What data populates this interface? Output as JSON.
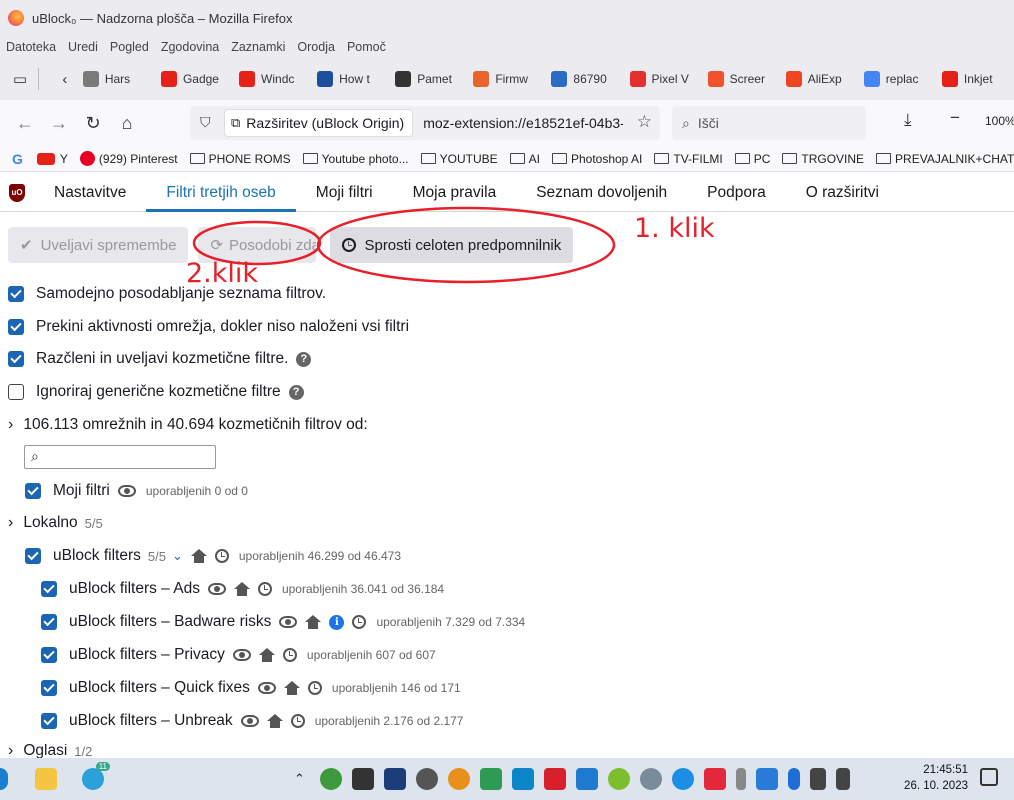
{
  "window": {
    "title": "uBlock₀ — Nadzorna plošča – Mozilla Firefox"
  },
  "menu": [
    "Datoteka",
    "Uredi",
    "Pogled",
    "Zgodovina",
    "Zaznamki",
    "Orodja",
    "Pomoč"
  ],
  "tabs": [
    {
      "label": "Hars",
      "color": "#7a7a7a"
    },
    {
      "label": "Gadge",
      "color": "#e62117"
    },
    {
      "label": "Windc",
      "color": "#e62117"
    },
    {
      "label": "How t",
      "color": "#1e4f9c"
    },
    {
      "label": "Pamet",
      "color": "#333333"
    },
    {
      "label": "Firmw",
      "color": "#e8642c"
    },
    {
      "label": "86790",
      "color": "#2a6bc4"
    },
    {
      "label": "Pixel V",
      "color": "#e53030"
    },
    {
      "label": "Screer",
      "color": "#f0522b"
    },
    {
      "label": "AliExp",
      "color": "#f04424"
    },
    {
      "label": "replac",
      "color": "#4285f4"
    },
    {
      "label": "Inkjet",
      "color": "#e62117"
    }
  ],
  "navbar": {
    "url_badge": "Razširitev (uBlock Origin)",
    "url": "moz-extension://e18521ef-04b3-",
    "search_placeholder": "Išči",
    "zoom": "100%"
  },
  "bookmarks": [
    {
      "label": "",
      "type": "google"
    },
    {
      "label": "Y",
      "type": "youtube"
    },
    {
      "label": "(929) Pinterest",
      "type": "pinterest"
    },
    {
      "label": "PHONE ROMS",
      "type": "folder"
    },
    {
      "label": "Youtube photo...",
      "type": "folder"
    },
    {
      "label": "YOUTUBE",
      "type": "folder"
    },
    {
      "label": "AI",
      "type": "folder"
    },
    {
      "label": "Photoshop AI",
      "type": "folder"
    },
    {
      "label": "TV-FILMI",
      "type": "folder"
    },
    {
      "label": "PC",
      "type": "folder"
    },
    {
      "label": "TRGOVINE",
      "type": "folder"
    },
    {
      "label": "PREVAJALNIK+CHAT",
      "type": "folder"
    }
  ],
  "ublock_tabs": [
    "Nastavitve",
    "Filtri tretjih oseb",
    "Moji filtri",
    "Moja pravila",
    "Seznam dovoljenih",
    "Podpora",
    "O razširitvi"
  ],
  "buttons": {
    "apply": "Uveljavi spremembe",
    "update": "Posodobi zdaj",
    "purge": "Sprosti celoten predpomnilnik"
  },
  "annotations": {
    "first": "1. klik",
    "second": "2.klik"
  },
  "options": [
    {
      "label": "Samodejno posodabljanje seznama filtrov.",
      "checked": true,
      "help": false
    },
    {
      "label": "Prekini aktivnosti omrežja, dokler niso naloženi vsi filtri",
      "checked": true,
      "help": false
    },
    {
      "label": "Razčleni in uveljavi kozmetične filtre.",
      "checked": true,
      "help": true
    },
    {
      "label": "Ignoriraj generične kozmetične filtre",
      "checked": false,
      "help": true
    }
  ],
  "summary": "106.113 omrežnih in 40.694 kozmetičnih filtrov od:",
  "filters": {
    "my_filters": {
      "label": "Moji filtri",
      "used": "uporabljenih 0 od 0"
    },
    "local": {
      "label": "Lokalno",
      "count": "5/5"
    },
    "ublock_group": {
      "label": "uBlock filters",
      "count": "5/5",
      "used": "uporabljenih 46.299 od 46.473"
    },
    "lists": [
      {
        "label": "uBlock filters – Ads",
        "used": "uporabljenih 36.041 od 36.184",
        "info": false
      },
      {
        "label": "uBlock filters – Badware risks",
        "used": "uporabljenih 7.329 od 7.334",
        "info": true
      },
      {
        "label": "uBlock filters – Privacy",
        "used": "uporabljenih 607 od 607",
        "info": false
      },
      {
        "label": "uBlock filters – Quick fixes",
        "used": "uporabljenih 146 od 171",
        "info": false
      },
      {
        "label": "uBlock filters – Unbreak",
        "used": "uporabljenih 2.176 od 2.177",
        "info": false
      }
    ],
    "ads": {
      "label": "Oglasi",
      "count": "1/2"
    }
  },
  "taskbar": {
    "time": "21:45:51",
    "date": "26. 10. 2023",
    "telegram_badge": "11"
  }
}
